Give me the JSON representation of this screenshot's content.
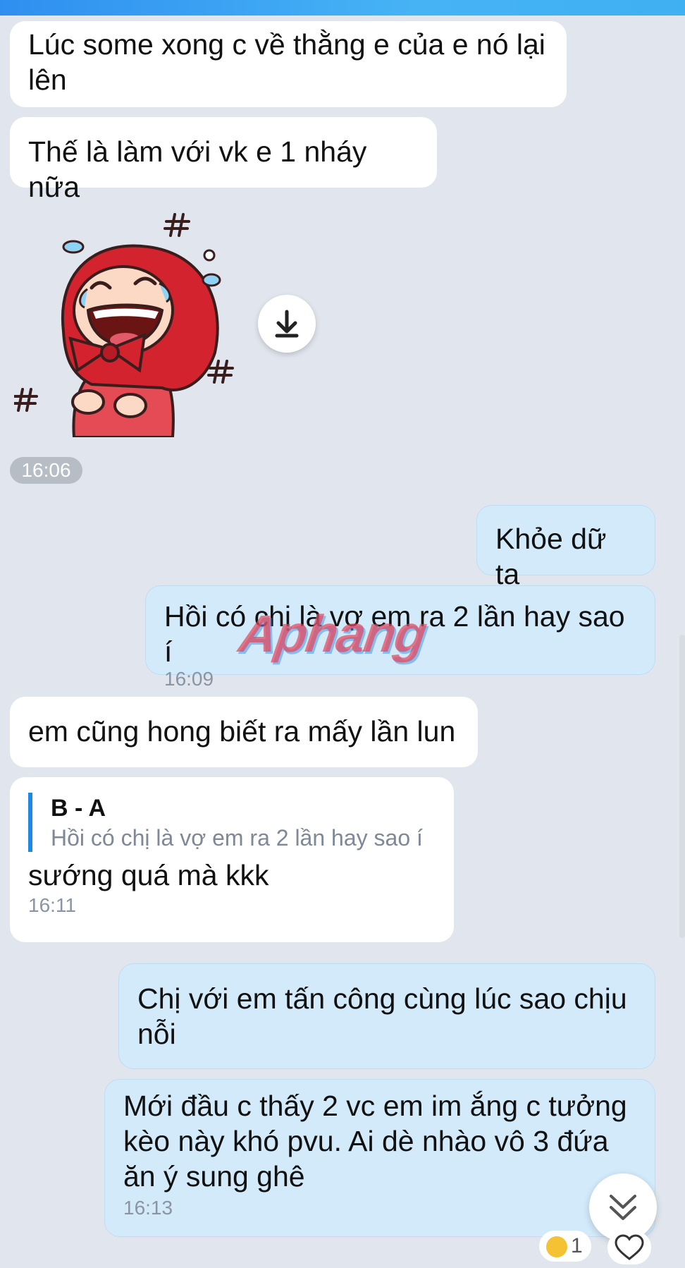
{
  "messages": {
    "m1": "Lúc some xong c về thằng e của e nó lại lên",
    "m2": "Thế là làm với vk e 1 nháy nữa",
    "sticker_time": "16:06",
    "m3": "Khỏe dữ ta",
    "m4": "Hồi có chị là vợ em ra 2 lần hay sao í",
    "m4_time": "16:09",
    "m5": "em cũng hong biết ra mấy lần lun",
    "m6": {
      "quote_name": "B - A",
      "quote_text": "Hồi có chị là vợ em ra 2 lần hay sao í",
      "text": "sướng quá mà kkk",
      "time": "16:11"
    },
    "m7": "Chị với em tấn công cùng lúc sao chịu nỗi",
    "m8": "Mới đầu c thấy 2 vc em im ắng c tưởng kèo này khó pvu. Ai dè nhào vô 3 đứa ăn ý sung ghê",
    "m8_time": "16:13"
  },
  "reaction": {
    "emoji": "laughing-emoji",
    "count": "1"
  },
  "watermark": "Aphang",
  "icons": {
    "download": "download-icon",
    "scroll_down": "double-chevron-down-icon",
    "like": "heart-icon",
    "sticker": "crying-laughing-girl-sticker"
  },
  "colors": {
    "background": "#e1e6ee",
    "incoming_bubble": "#ffffff",
    "outgoing_bubble": "#d3eafb",
    "quote_bar": "#1e88e5"
  }
}
